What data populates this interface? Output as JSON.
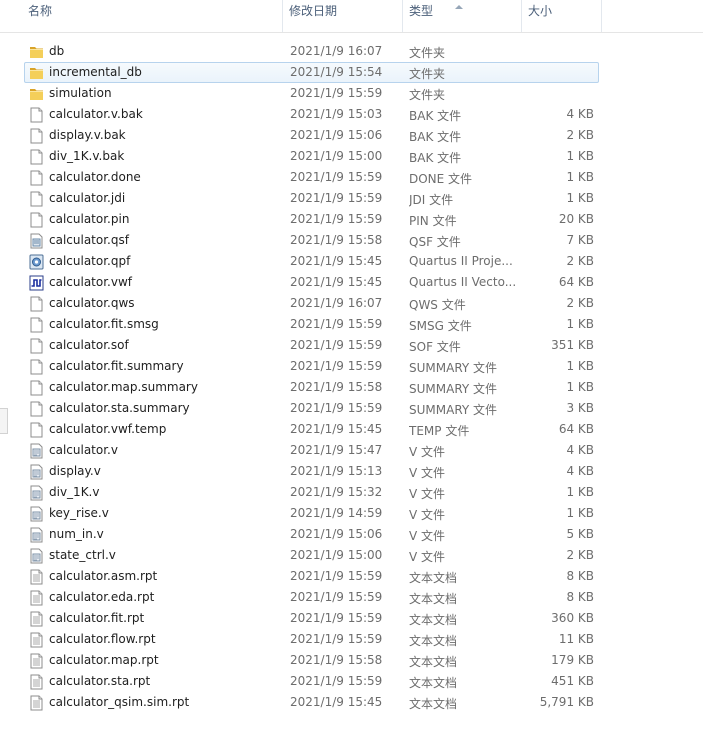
{
  "columns": {
    "name": "名称",
    "date": "修改日期",
    "type": "类型",
    "size": "大小"
  },
  "colors": {
    "folder": "#e8b93a",
    "selection_border": "#b7d3ed",
    "header_text": "#4c607a"
  },
  "files": [
    {
      "name": "db",
      "date": "2021/1/9 16:07",
      "type": "文件夹",
      "size": "",
      "icon": "folder-icon"
    },
    {
      "name": "incremental_db",
      "date": "2021/1/9 15:54",
      "type": "文件夹",
      "size": "",
      "icon": "folder-icon"
    },
    {
      "name": "simulation",
      "date": "2021/1/9 15:59",
      "type": "文件夹",
      "size": "",
      "icon": "folder-icon"
    },
    {
      "name": "calculator.v.bak",
      "date": "2021/1/9 15:03",
      "type": "BAK 文件",
      "size": "4 KB",
      "icon": "file-icon"
    },
    {
      "name": "display.v.bak",
      "date": "2021/1/9 15:06",
      "type": "BAK 文件",
      "size": "2 KB",
      "icon": "file-icon"
    },
    {
      "name": "div_1K.v.bak",
      "date": "2021/1/9 15:00",
      "type": "BAK 文件",
      "size": "1 KB",
      "icon": "file-icon"
    },
    {
      "name": "calculator.done",
      "date": "2021/1/9 15:59",
      "type": "DONE 文件",
      "size": "1 KB",
      "icon": "file-icon"
    },
    {
      "name": "calculator.jdi",
      "date": "2021/1/9 15:59",
      "type": "JDI 文件",
      "size": "1 KB",
      "icon": "file-icon"
    },
    {
      "name": "calculator.pin",
      "date": "2021/1/9 15:59",
      "type": "PIN 文件",
      "size": "20 KB",
      "icon": "file-icon"
    },
    {
      "name": "calculator.qsf",
      "date": "2021/1/9 15:58",
      "type": "QSF 文件",
      "size": "7 KB",
      "icon": "config-file-icon"
    },
    {
      "name": "calculator.qpf",
      "date": "2021/1/9 15:45",
      "type": "Quartus II Proje...",
      "size": "2 KB",
      "icon": "quartus-project-icon"
    },
    {
      "name": "calculator.vwf",
      "date": "2021/1/9 15:45",
      "type": "Quartus II Vecto...",
      "size": "64 KB",
      "icon": "waveform-file-icon"
    },
    {
      "name": "calculator.qws",
      "date": "2021/1/9 16:07",
      "type": "QWS 文件",
      "size": "2 KB",
      "icon": "file-icon"
    },
    {
      "name": "calculator.fit.smsg",
      "date": "2021/1/9 15:59",
      "type": "SMSG 文件",
      "size": "1 KB",
      "icon": "file-icon"
    },
    {
      "name": "calculator.sof",
      "date": "2021/1/9 15:59",
      "type": "SOF 文件",
      "size": "351 KB",
      "icon": "file-icon"
    },
    {
      "name": "calculator.fit.summary",
      "date": "2021/1/9 15:59",
      "type": "SUMMARY 文件",
      "size": "1 KB",
      "icon": "file-icon"
    },
    {
      "name": "calculator.map.summary",
      "date": "2021/1/9 15:58",
      "type": "SUMMARY 文件",
      "size": "1 KB",
      "icon": "file-icon"
    },
    {
      "name": "calculator.sta.summary",
      "date": "2021/1/9 15:59",
      "type": "SUMMARY 文件",
      "size": "3 KB",
      "icon": "file-icon"
    },
    {
      "name": "calculator.vwf.temp",
      "date": "2021/1/9 15:45",
      "type": "TEMP 文件",
      "size": "64 KB",
      "icon": "file-icon"
    },
    {
      "name": "calculator.v",
      "date": "2021/1/9 15:47",
      "type": "V 文件",
      "size": "4 KB",
      "icon": "v-file-icon"
    },
    {
      "name": "display.v",
      "date": "2021/1/9 15:13",
      "type": "V 文件",
      "size": "4 KB",
      "icon": "v-file-icon"
    },
    {
      "name": "div_1K.v",
      "date": "2021/1/9 15:32",
      "type": "V 文件",
      "size": "1 KB",
      "icon": "v-file-icon"
    },
    {
      "name": "key_rise.v",
      "date": "2021/1/9 14:59",
      "type": "V 文件",
      "size": "1 KB",
      "icon": "v-file-icon"
    },
    {
      "name": "num_in.v",
      "date": "2021/1/9 15:06",
      "type": "V 文件",
      "size": "5 KB",
      "icon": "v-file-icon"
    },
    {
      "name": "state_ctrl.v",
      "date": "2021/1/9 15:00",
      "type": "V 文件",
      "size": "2 KB",
      "icon": "v-file-icon"
    },
    {
      "name": "calculator.asm.rpt",
      "date": "2021/1/9 15:59",
      "type": "文本文档",
      "size": "8 KB",
      "icon": "text-document-icon"
    },
    {
      "name": "calculator.eda.rpt",
      "date": "2021/1/9 15:59",
      "type": "文本文档",
      "size": "8 KB",
      "icon": "text-document-icon"
    },
    {
      "name": "calculator.fit.rpt",
      "date": "2021/1/9 15:59",
      "type": "文本文档",
      "size": "360 KB",
      "icon": "text-document-icon"
    },
    {
      "name": "calculator.flow.rpt",
      "date": "2021/1/9 15:59",
      "type": "文本文档",
      "size": "11 KB",
      "icon": "text-document-icon"
    },
    {
      "name": "calculator.map.rpt",
      "date": "2021/1/9 15:58",
      "type": "文本文档",
      "size": "179 KB",
      "icon": "text-document-icon"
    },
    {
      "name": "calculator.sta.rpt",
      "date": "2021/1/9 15:59",
      "type": "文本文档",
      "size": "451 KB",
      "icon": "text-document-icon"
    },
    {
      "name": "calculator_qsim.sim.rpt",
      "date": "2021/1/9 15:45",
      "type": "文本文档",
      "size": "5,791 KB",
      "icon": "text-document-icon"
    }
  ],
  "selected_index": 1
}
